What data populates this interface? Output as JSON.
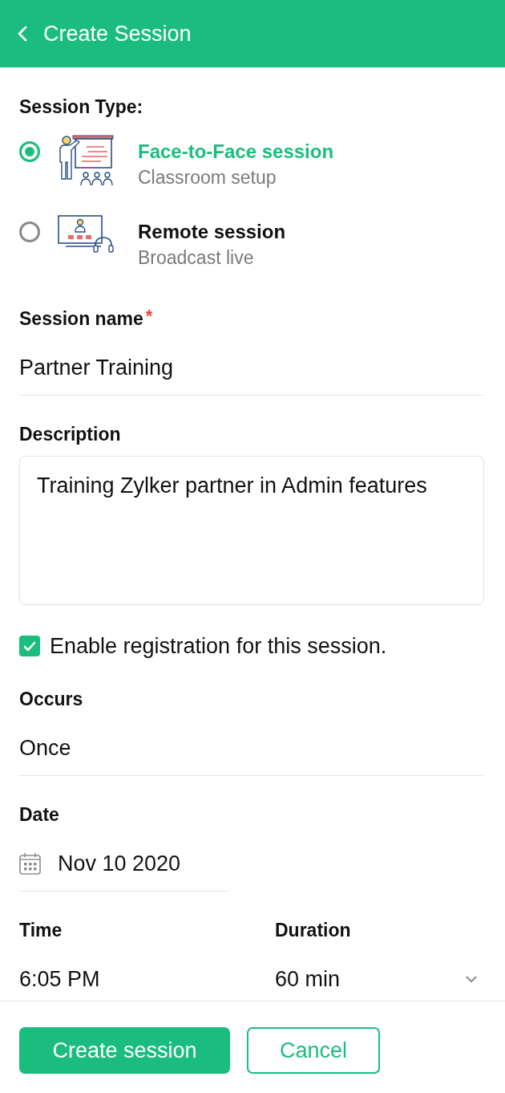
{
  "header": {
    "title": "Create Session"
  },
  "session_type": {
    "label": "Session Type:",
    "options": [
      {
        "kind": "classroom",
        "title": "Face-to-Face session",
        "subtitle": "Classroom setup",
        "selected": true
      },
      {
        "kind": "remote",
        "title": "Remote session",
        "subtitle": "Broadcast live",
        "selected": false
      }
    ]
  },
  "session_name": {
    "label": "Session name",
    "required_mark": "*",
    "value": "Partner Training"
  },
  "description": {
    "label": "Description",
    "value": "Training Zylker partner in Admin features"
  },
  "registration": {
    "label": "Enable registration for this session.",
    "checked": true
  },
  "occurs": {
    "label": "Occurs",
    "value": "Once"
  },
  "date": {
    "label": "Date",
    "value": "Nov 10 2020"
  },
  "time": {
    "label": "Time",
    "value": "6:05 PM"
  },
  "duration": {
    "label": "Duration",
    "value": "60 min"
  },
  "buttons": [
    {
      "kind": "primary",
      "label": "Create session"
    },
    {
      "kind": "secondary",
      "label": "Cancel"
    }
  ]
}
